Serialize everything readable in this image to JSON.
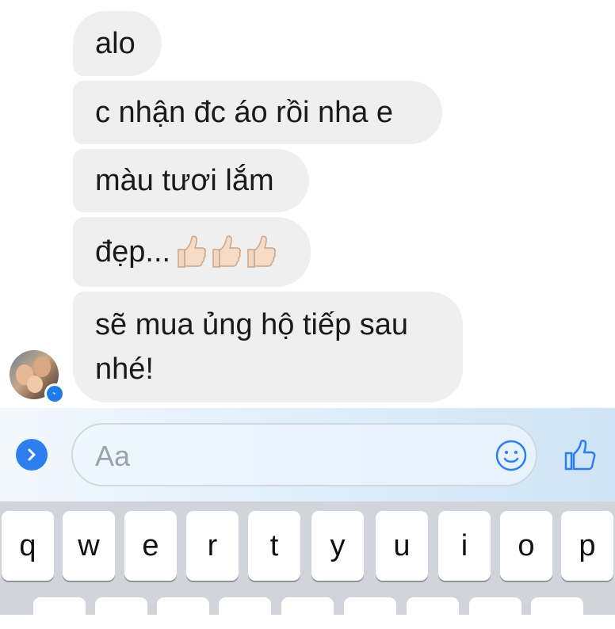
{
  "messages": [
    {
      "text": "alo"
    },
    {
      "text": "c nhận đc áo rồi nha e"
    },
    {
      "text": "màu tươi lắm"
    },
    {
      "text": "đẹp..."
    },
    {
      "text": "sẽ mua ủng hộ tiếp sau nhé!"
    }
  ],
  "emoji": {
    "thumbs_up_count": 3,
    "name": "thumbs-up-light-skin"
  },
  "composer": {
    "placeholder": "Aa"
  },
  "keyboard": {
    "row1": [
      "q",
      "w",
      "e",
      "r",
      "t",
      "y",
      "u",
      "i",
      "o",
      "p"
    ]
  },
  "colors": {
    "bubble": "#efefef",
    "accent": "#2d7ff0",
    "keyboard_bg": "#d1d4da"
  },
  "icons": [
    "messenger-badge-icon",
    "expand-arrow-icon",
    "smiley-icon",
    "like-thumb-icon"
  ]
}
